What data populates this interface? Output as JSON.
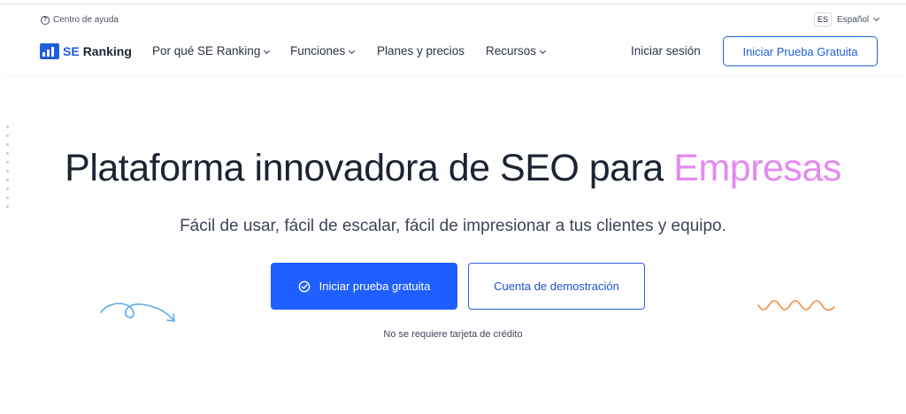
{
  "utility": {
    "help_label": "Centro de ayuda",
    "lang_code": "ES",
    "lang_label": "Español"
  },
  "nav": {
    "logo_se": "SE",
    "logo_ranking": "Ranking",
    "items": [
      {
        "label": "Por qué SE Ranking"
      },
      {
        "label": "Funciones"
      },
      {
        "label": "Planes y precios"
      },
      {
        "label": "Recursos"
      }
    ],
    "signin_label": "Iniciar sesión",
    "trial_label": "Iniciar Prueba Gratuita"
  },
  "hero": {
    "title_main": "Plataforma innovadora de SEO para ",
    "title_accent": "Empresas",
    "subtitle": "Fácil de usar, fácil de escalar, fácil de impresionar a tus clientes y equipo.",
    "primary_label": "Iniciar prueba gratuita",
    "secondary_label": "Cuenta de demostración",
    "note": "No se requiere tarjeta de crédito"
  },
  "colors": {
    "brand_blue": "#1f5fff",
    "accent_pink": "#e38af0",
    "deco_left": "#5aa9e6",
    "deco_right": "#f08a3c"
  },
  "icons": {
    "help": "help-circle-icon",
    "chevron": "chevron-down-icon",
    "check": "check-circle-icon"
  }
}
